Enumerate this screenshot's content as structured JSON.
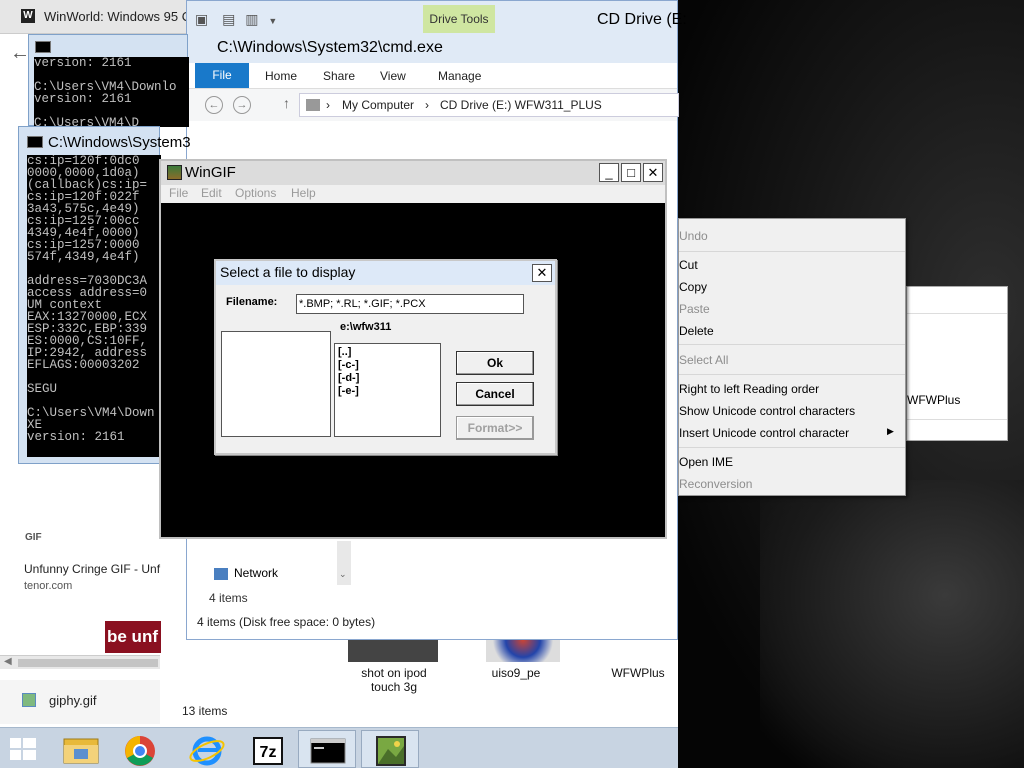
{
  "browser": {
    "tab_title": "WinWorld: Windows 95 OS",
    "logo_text": "W",
    "gif_card": {
      "label": "GIF",
      "title": "Unfunny Cringe GIF - Unf",
      "domain": "tenor.com",
      "thumb_text": "be unf"
    },
    "download": {
      "filename": "giphy.gif"
    }
  },
  "cmd_top": {
    "lines": "version: 2161\n\nC:\\Users\\VM4\\Downlo\nversion: 2161\n\nC:\\Users\\VM4\\D"
  },
  "cmd_main": {
    "title": "C:\\Windows\\System3",
    "lines": "cs:ip=120f:0dc0\n0000,0000,1d0a)\n(callback)cs:ip=\ncs:ip=120f:022f\n3a43,575c,4e49)\ncs:ip=1257:00cc\n4349,4e4f,0000)\ncs:ip=1257:0000\n574f,4349,4e4f)\n\naddress=7030DC3A\naccess address=0\nUM context\nEAX:13270000,ECX\nESP:332C,EBP:339\nES:0000,CS:10FF,\nIP:2942, address\nEFLAGS:00003202\n\nSEGU\n\nC:\\Users\\VM4\\Down\nXE\nversion: 2161"
  },
  "explorer": {
    "contextual_tab": "Drive Tools",
    "window_title_right": "CD Drive (E:",
    "cmd_title": "C:\\Windows\\System32\\cmd.exe",
    "ribbon_tabs": [
      "File",
      "Home",
      "Share",
      "View",
      "Manage"
    ],
    "address": {
      "root": "My Computer",
      "separator": "›",
      "path": "CD Drive (E:) WFW311_PLUS"
    },
    "nav_network": "Network",
    "items_count": "4 items",
    "status": "4 items (Disk free space: 0 bytes)"
  },
  "desktop": {
    "icons": [
      {
        "label_line1": "shot on ipod",
        "label_line2": "touch 3g"
      },
      {
        "label_line1": "uiso9_pe",
        "label_line2": ""
      },
      {
        "label_line1": "WFWPlus",
        "label_line2": ""
      }
    ],
    "items_count": "13 items"
  },
  "wingif": {
    "title": "WinGIF",
    "menu": [
      "File",
      "Edit",
      "Options",
      "Help"
    ],
    "dialog": {
      "title": "Select a file to display",
      "filename_label": "Filename:",
      "filename_value": "*.BMP; *.RL; *.GIF; *.PCX",
      "current_dir": "e:\\wfw311",
      "dirs": [
        "[..]",
        "[-c-]",
        "[-d-]",
        "[-e-]"
      ],
      "ok_label": "Ok",
      "cancel_label": "Cancel",
      "format_label": "Format>>"
    }
  },
  "context_menu": {
    "items": [
      {
        "label": "Undo",
        "disabled": true
      },
      {
        "label": "Cut",
        "disabled": false
      },
      {
        "label": "Copy",
        "disabled": false
      },
      {
        "label": "Paste",
        "disabled": true
      },
      {
        "label": "Delete",
        "disabled": false
      },
      {
        "label": "Select All",
        "disabled": true
      },
      {
        "label": "Right to left Reading order",
        "disabled": false
      },
      {
        "label": "Show Unicode control characters",
        "disabled": false
      },
      {
        "label": "Insert Unicode control character",
        "disabled": false
      },
      {
        "label": "Open IME",
        "disabled": false
      },
      {
        "label": "Reconversion",
        "disabled": true
      }
    ],
    "submenu_text": "WFWPlus"
  },
  "taskbar": {
    "items": [
      "file-explorer",
      "chrome",
      "internet-explorer",
      "7zip",
      "command-prompt",
      "wingif"
    ]
  },
  "colors": {
    "file_tab": "#1979ca",
    "drive_tools": "#cfe6a1",
    "taskbar": "#c8d4e2"
  }
}
